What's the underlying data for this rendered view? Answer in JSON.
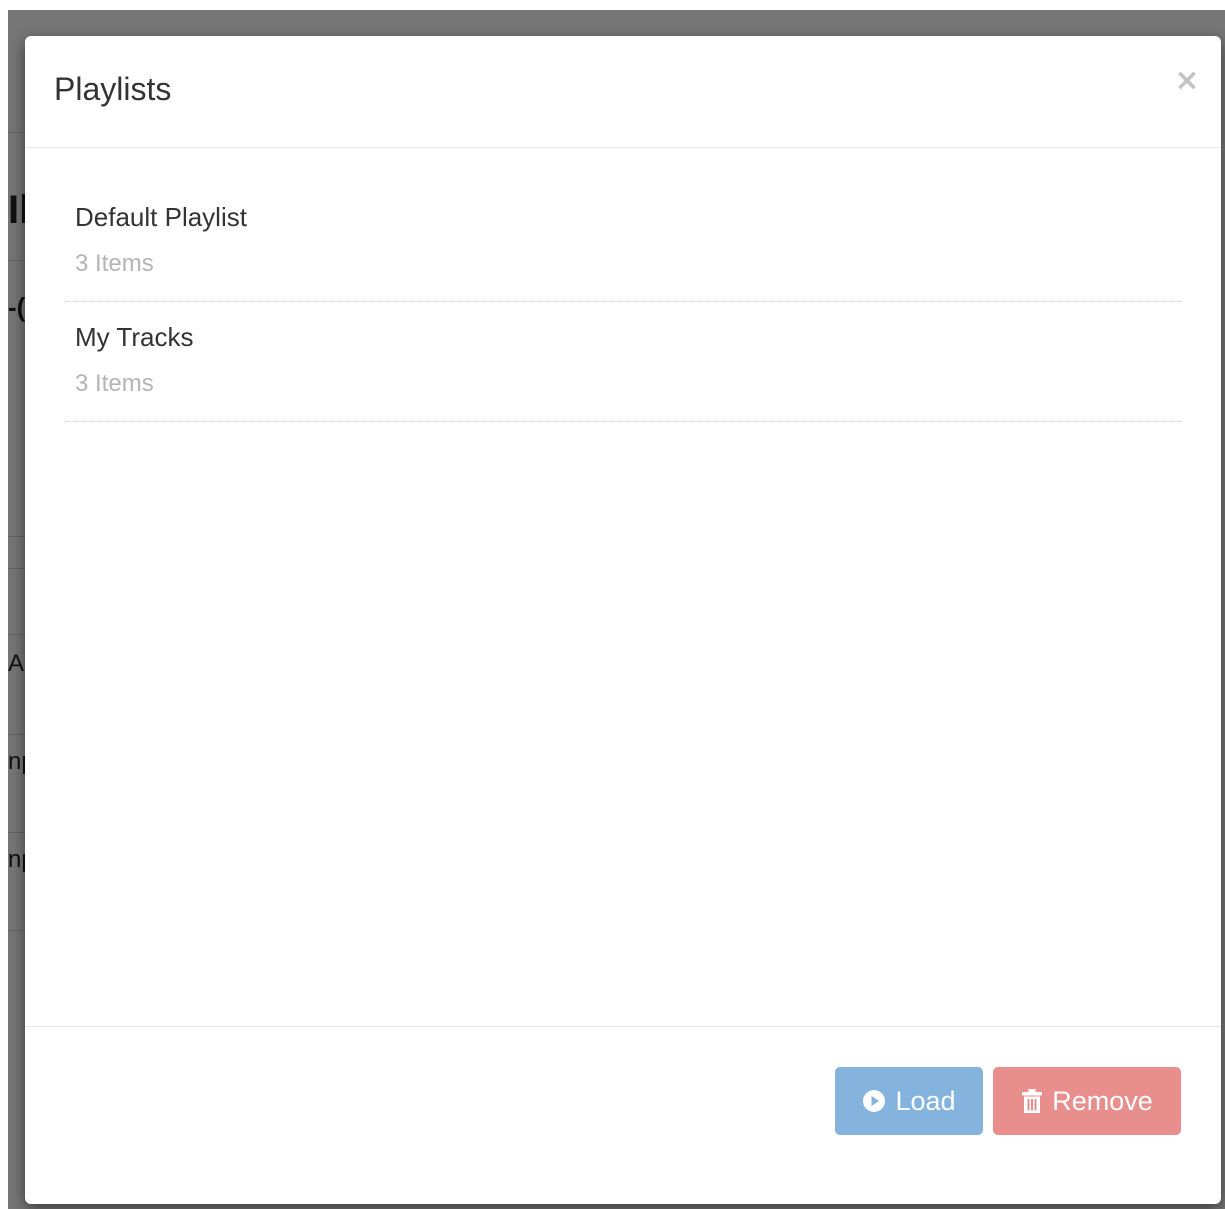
{
  "background": {
    "fragments": [
      "Il",
      "-(",
      "Ar",
      "np",
      "np"
    ]
  },
  "modal": {
    "title": "Playlists",
    "close_glyph": "×",
    "playlists": [
      {
        "name": "Default Playlist",
        "count": "3 Items"
      },
      {
        "name": "My Tracks",
        "count": "3 Items"
      }
    ],
    "footer": {
      "load_label": "Load",
      "load_icon": "play-circle-icon",
      "remove_label": "Remove",
      "remove_icon": "trash-icon"
    }
  },
  "colors": {
    "load_button": "#84b3dd",
    "remove_button": "#e88e8c",
    "muted_text": "#b4b4b4"
  }
}
